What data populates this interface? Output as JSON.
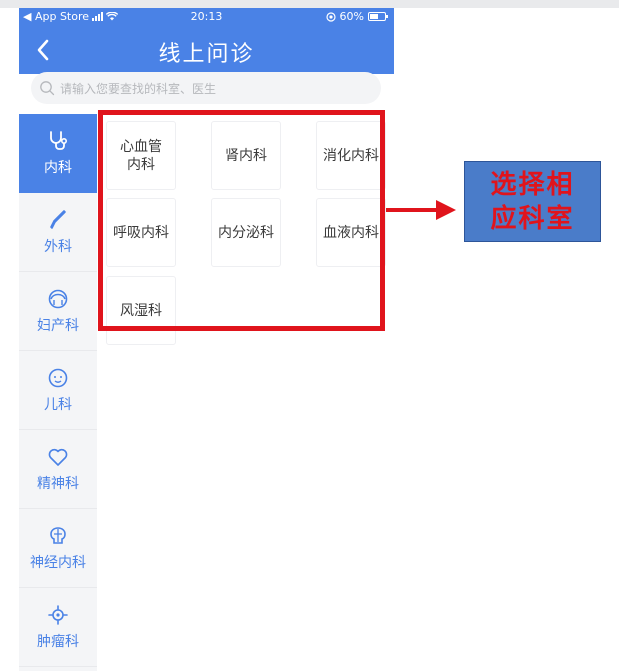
{
  "status_bar": {
    "carrier": "◀ App Store",
    "time": "20:13",
    "battery_percent": "60%",
    "battery_level": 0.6
  },
  "nav": {
    "title": "线上问诊"
  },
  "search": {
    "placeholder": "请输入您要查找的科室、医生"
  },
  "sidebar": {
    "items": [
      {
        "label": "内科",
        "icon": "stethoscope-icon",
        "active": true
      },
      {
        "label": "外科",
        "icon": "scalpel-icon",
        "active": false
      },
      {
        "label": "妇产科",
        "icon": "female-face-icon",
        "active": false
      },
      {
        "label": "儿科",
        "icon": "child-face-icon",
        "active": false
      },
      {
        "label": "精神科",
        "icon": "heart-icon",
        "active": false
      },
      {
        "label": "神经内科",
        "icon": "brain-icon",
        "active": false
      },
      {
        "label": "肿瘤科",
        "icon": "tumor-icon",
        "active": false
      }
    ]
  },
  "departments": [
    {
      "line1": "心血管",
      "line2": "内科"
    },
    {
      "line1": "肾内科",
      "line2": ""
    },
    {
      "line1": "消化内科",
      "line2": ""
    },
    {
      "line1": "呼吸内科",
      "line2": ""
    },
    {
      "line1": "内分泌科",
      "line2": ""
    },
    {
      "line1": "血液内科",
      "line2": ""
    },
    {
      "line1": "风湿科",
      "line2": ""
    }
  ],
  "annotation": {
    "line1": "选择相",
    "line2": "应科室",
    "box_color": "#e0141c",
    "callout_bg": "#4a7cc9"
  },
  "colors": {
    "brand_blue": "#4a82e6",
    "annotation_red": "#e0141c"
  }
}
